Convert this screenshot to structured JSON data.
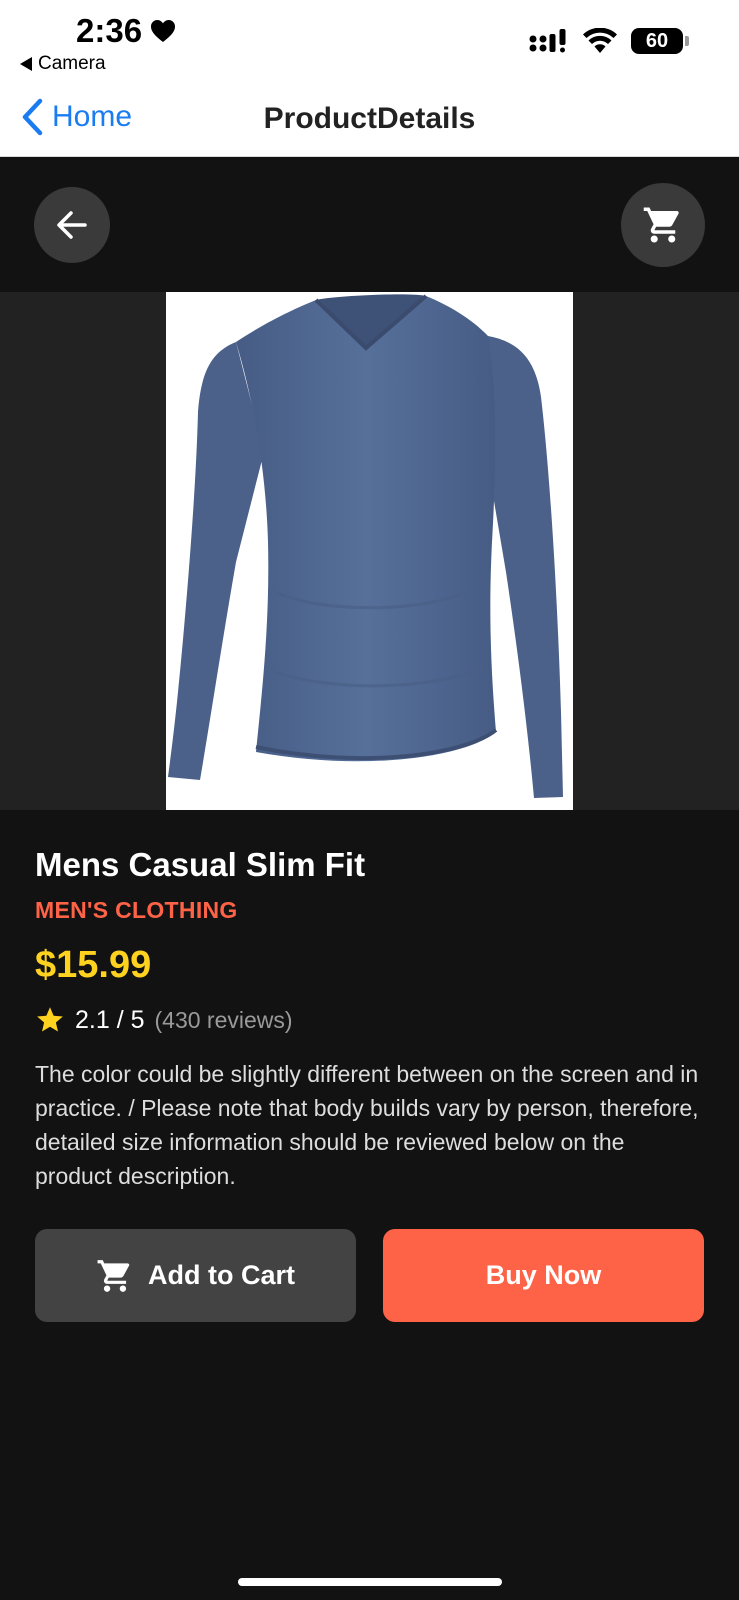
{
  "status_bar": {
    "time": "2:36",
    "back_to_app": "Camera",
    "battery": "60"
  },
  "nav": {
    "back_label": "Home",
    "title": "ProductDetails"
  },
  "product": {
    "title": "Mens Casual Slim Fit",
    "category": "MEN'S CLOTHING",
    "price": "$15.99",
    "rating": "2.1 / 5",
    "reviews": "(430 reviews)",
    "description": "The color could be slightly different between on the screen and in practice. / Please note that body builds vary by person, therefore, detailed size information should be reviewed below on the product description."
  },
  "actions": {
    "add_to_cart": "Add to Cart",
    "buy_now": "Buy Now"
  },
  "colors": {
    "accent": "#ff6347",
    "price": "#ffd21f",
    "link": "#1a7cf0",
    "background": "#121212"
  },
  "icons": [
    "heart-icon",
    "signal-icon",
    "wifi-icon",
    "battery-icon",
    "chevron-left-icon",
    "arrow-left-icon",
    "cart-icon",
    "star-icon"
  ]
}
